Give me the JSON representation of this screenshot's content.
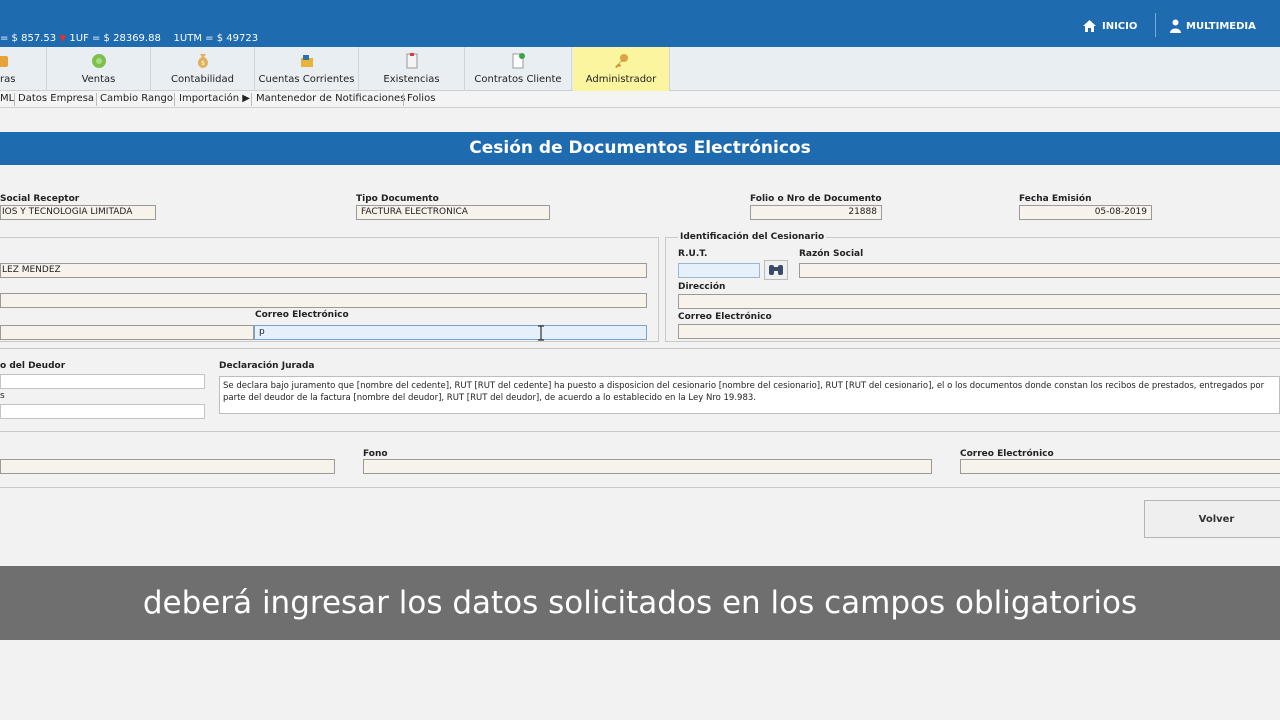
{
  "header": {
    "indicators": {
      "dolar": "= $ 857.53",
      "uf": "1UF = $ 28369.88",
      "utm": "1UTM = $ 49723"
    },
    "nav": {
      "inicio": "INICIO",
      "multimedia": "MULTIMEDIA"
    }
  },
  "modules": {
    "items": [
      {
        "label": "ras",
        "icon": "purchase-icon"
      },
      {
        "label": "Ventas",
        "icon": "sales-icon"
      },
      {
        "label": "Contabilidad",
        "icon": "money-bag-icon"
      },
      {
        "label": "Cuentas Corrientes",
        "icon": "accounts-icon"
      },
      {
        "label": "Existencias",
        "icon": "clipboard-icon"
      },
      {
        "label": "Contratos Cliente",
        "icon": "contract-icon"
      },
      {
        "label": "Administrador",
        "icon": "key-icon"
      }
    ],
    "active": "Administrador"
  },
  "submenu": {
    "items": [
      "ML",
      "Datos Empresa",
      "Cambio Rango",
      "Importación ▶",
      "Mantenedor de Notificaciones",
      "Folios"
    ]
  },
  "page": {
    "title": "Cesión de Documentos Electrónicos"
  },
  "document": {
    "razon_social_label": "Social Receptor",
    "razon_social_value": "IOS Y TECNOLOGIA LIMITADA",
    "tipo_label": "Tipo Documento",
    "tipo_value": "FACTURA ELECTRONICA",
    "folio_label": "Folio o Nro de Documento",
    "folio_value": "21888",
    "fecha_label": "Fecha Emisión",
    "fecha_value": "05-08-2019"
  },
  "cedente": {
    "nombre_value": "LEZ MENDEZ",
    "correo_label": "Correo Electrónico",
    "correo_value": "p"
  },
  "cesionario": {
    "legend": "Identificación del Cesionario",
    "rut_label": "R.U.T.",
    "razon_label": "Razón Social",
    "direccion_label": "Dirección",
    "correo_label": "Correo Electrónico"
  },
  "deudor": {
    "label": "o del Deudor",
    "second_label": "s"
  },
  "declaracion": {
    "label": "Declaración Jurada",
    "text": "Se declara bajo juramento que [nombre del cedente], RUT [RUT del cedente] ha puesto a disposicion del cesionario [nombre del cesionario], RUT [RUT del cesionario], el o los documentos donde constan los recibos de prestados, entregados por parte del deudor de la factura [nombre del deudor], RUT [RUT del deudor], de acuerdo a lo establecido en la Ley Nro 19.983."
  },
  "contacto": {
    "fono_label": "Fono",
    "correo_label": "Correo Electrónico"
  },
  "actions": {
    "volver": "Volver"
  },
  "caption": {
    "text": "deberá ingresar los datos solicitados en los campos obligatorios"
  },
  "colors": {
    "primary": "#1e6bb0",
    "active_module": "#fbf5a0",
    "field_bg": "#f7f2ea",
    "caption_band": "#6f6f6f"
  }
}
